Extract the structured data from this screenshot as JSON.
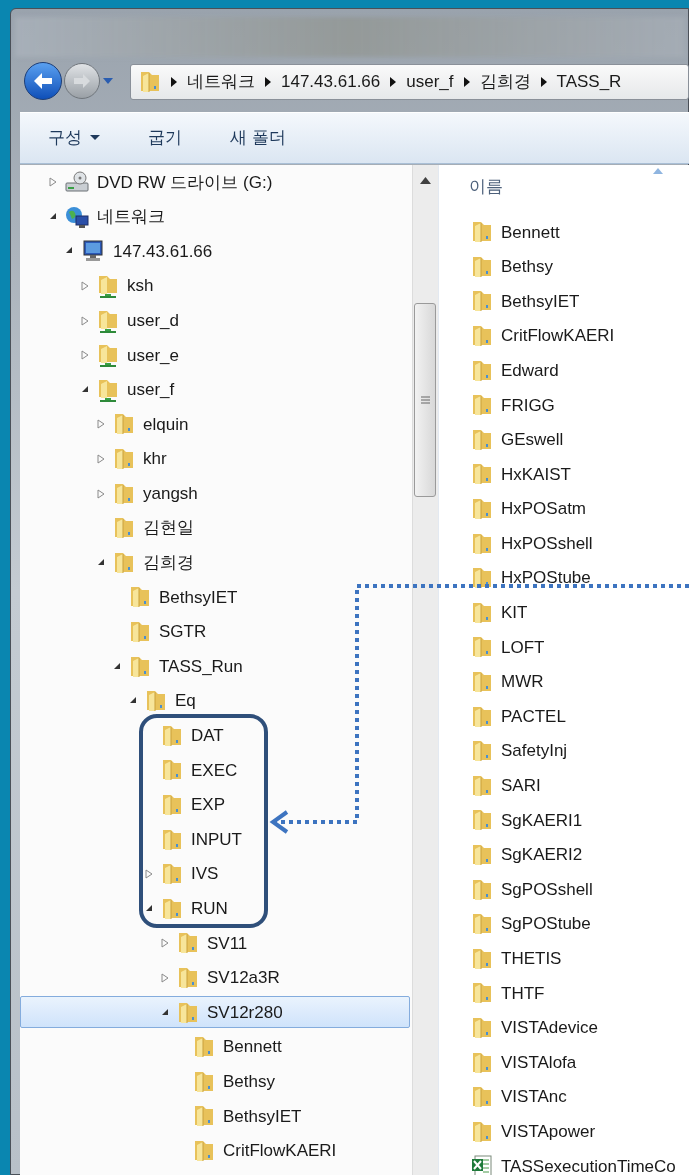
{
  "address_bar": {
    "crumbs": [
      "네트워크",
      "147.43.61.66",
      "user_f",
      "김희경",
      "TASS_R"
    ]
  },
  "toolbar": {
    "items": [
      {
        "label": "구성",
        "dropdown": true
      },
      {
        "label": "굽기",
        "dropdown": false
      },
      {
        "label": "새 폴더",
        "dropdown": false
      }
    ]
  },
  "nav_tree": [
    {
      "label": "DVD RW 드라이브 (G:)",
      "kind": "drive",
      "expandable": true,
      "expanded": false,
      "selected": false
    },
    {
      "label": "네트워크",
      "kind": "network",
      "expandable": true,
      "expanded": true,
      "selected": false,
      "children": [
        {
          "label": "147.43.61.66",
          "kind": "computer",
          "expandable": true,
          "expanded": true,
          "selected": false,
          "children": [
            {
              "label": "ksh",
              "kind": "share",
              "expandable": true,
              "expanded": false,
              "selected": false
            },
            {
              "label": "user_d",
              "kind": "share",
              "expandable": true,
              "expanded": false,
              "selected": false
            },
            {
              "label": "user_e",
              "kind": "share",
              "expandable": true,
              "expanded": false,
              "selected": false
            },
            {
              "label": "user_f",
              "kind": "share",
              "expandable": true,
              "expanded": true,
              "selected": false,
              "children": [
                {
                  "label": "elquin",
                  "kind": "folder",
                  "expandable": true,
                  "expanded": false,
                  "selected": false
                },
                {
                  "label": "khr",
                  "kind": "folder",
                  "expandable": true,
                  "expanded": false,
                  "selected": false
                },
                {
                  "label": "yangsh",
                  "kind": "folder",
                  "expandable": true,
                  "expanded": false,
                  "selected": false
                },
                {
                  "label": "김현일",
                  "kind": "folder",
                  "expandable": false,
                  "expanded": false,
                  "selected": false
                },
                {
                  "label": "김희경",
                  "kind": "folder",
                  "expandable": true,
                  "expanded": true,
                  "selected": false,
                  "children": [
                    {
                      "label": "BethsyIET",
                      "kind": "folder",
                      "expandable": false,
                      "expanded": false,
                      "selected": false
                    },
                    {
                      "label": "SGTR",
                      "kind": "folder",
                      "expandable": false,
                      "expanded": false,
                      "selected": false
                    },
                    {
                      "label": "TASS_Run",
                      "kind": "folder",
                      "expandable": true,
                      "expanded": true,
                      "selected": false,
                      "children": [
                        {
                          "label": "Eq",
                          "kind": "folder",
                          "expandable": true,
                          "expanded": true,
                          "selected": false,
                          "children": [
                            {
                              "label": "DAT",
                              "kind": "folder",
                              "expandable": false,
                              "expanded": false,
                              "selected": false
                            },
                            {
                              "label": "EXEC",
                              "kind": "folder",
                              "expandable": false,
                              "expanded": false,
                              "selected": false
                            },
                            {
                              "label": "EXP",
                              "kind": "folder",
                              "expandable": false,
                              "expanded": false,
                              "selected": false
                            },
                            {
                              "label": "INPUT",
                              "kind": "folder",
                              "expandable": false,
                              "expanded": false,
                              "selected": false
                            },
                            {
                              "label": "IVS",
                              "kind": "folder",
                              "expandable": true,
                              "expanded": false,
                              "selected": false
                            },
                            {
                              "label": "RUN",
                              "kind": "folder",
                              "expandable": true,
                              "expanded": true,
                              "selected": false,
                              "children": [
                                {
                                  "label": "SV11",
                                  "kind": "folder",
                                  "expandable": true,
                                  "expanded": false,
                                  "selected": false
                                },
                                {
                                  "label": "SV12a3R",
                                  "kind": "folder",
                                  "expandable": true,
                                  "expanded": false,
                                  "selected": false
                                },
                                {
                                  "label": "SV12r280",
                                  "kind": "folder",
                                  "expandable": true,
                                  "expanded": true,
                                  "selected": true,
                                  "children": [
                                    {
                                      "label": "Bennett",
                                      "kind": "folder",
                                      "expandable": false,
                                      "expanded": false,
                                      "selected": false
                                    },
                                    {
                                      "label": "Bethsy",
                                      "kind": "folder",
                                      "expandable": false,
                                      "expanded": false,
                                      "selected": false
                                    },
                                    {
                                      "label": "BethsyIET",
                                      "kind": "folder",
                                      "expandable": false,
                                      "expanded": false,
                                      "selected": false
                                    },
                                    {
                                      "label": "CritFlowKAERI",
                                      "kind": "folder",
                                      "expandable": false,
                                      "expanded": false,
                                      "selected": false
                                    }
                                  ]
                                }
                              ]
                            }
                          ]
                        }
                      ]
                    }
                  ]
                }
              ]
            }
          ]
        }
      ]
    }
  ],
  "file_list": {
    "column": "이름",
    "items": [
      {
        "name": "Bennett",
        "kind": "folder"
      },
      {
        "name": "Bethsy",
        "kind": "folder"
      },
      {
        "name": "BethsyIET",
        "kind": "folder"
      },
      {
        "name": "CritFlowKAERI",
        "kind": "folder"
      },
      {
        "name": "Edward",
        "kind": "folder"
      },
      {
        "name": "FRIGG",
        "kind": "folder"
      },
      {
        "name": "GEswell",
        "kind": "folder"
      },
      {
        "name": "HxKAIST",
        "kind": "folder"
      },
      {
        "name": "HxPOSatm",
        "kind": "folder"
      },
      {
        "name": "HxPOSshell",
        "kind": "folder"
      },
      {
        "name": "HxPOStube",
        "kind": "folder"
      },
      {
        "name": "KIT",
        "kind": "folder"
      },
      {
        "name": "LOFT",
        "kind": "folder"
      },
      {
        "name": "MWR",
        "kind": "folder"
      },
      {
        "name": "PACTEL",
        "kind": "folder"
      },
      {
        "name": "SafetyInj",
        "kind": "folder"
      },
      {
        "name": "SARI",
        "kind": "folder"
      },
      {
        "name": "SgKAERI1",
        "kind": "folder"
      },
      {
        "name": "SgKAERI2",
        "kind": "folder"
      },
      {
        "name": "SgPOSshell",
        "kind": "folder"
      },
      {
        "name": "SgPOStube",
        "kind": "folder"
      },
      {
        "name": "THETIS",
        "kind": "folder"
      },
      {
        "name": "THTF",
        "kind": "folder"
      },
      {
        "name": "VISTAdevice",
        "kind": "folder"
      },
      {
        "name": "VISTAlofa",
        "kind": "folder"
      },
      {
        "name": "VISTAnc",
        "kind": "folder"
      },
      {
        "name": "VISTApower",
        "kind": "folder"
      },
      {
        "name": "TASSexecutionTimeCo",
        "kind": "spreadsheet"
      }
    ]
  }
}
